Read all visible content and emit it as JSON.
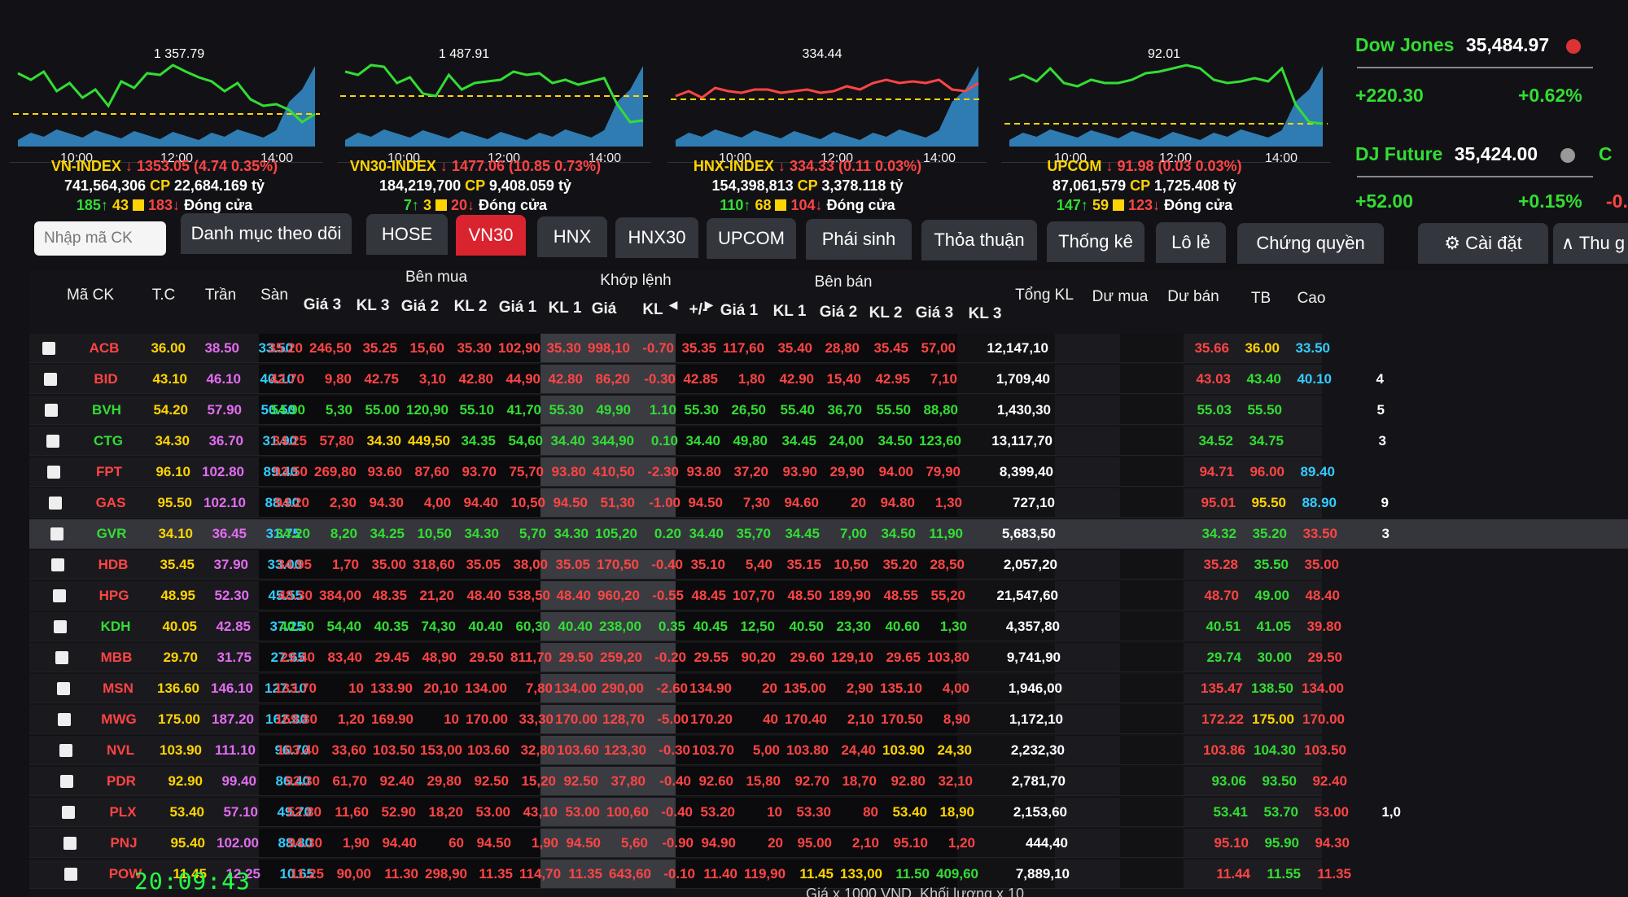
{
  "charts": [
    {
      "peak": "1 357.79",
      "times": [
        "10:00",
        "12:00",
        "14:00"
      ]
    },
    {
      "peak": "1 487.91",
      "times": [
        "10:00",
        "12:00",
        "14:00"
      ]
    },
    {
      "peak": "334.44",
      "times": [
        "10:00",
        "12:00",
        "14:00"
      ]
    },
    {
      "peak": "92.01",
      "times": [
        "10:00",
        "12:00",
        "14:00"
      ]
    }
  ],
  "indices": [
    {
      "name": "VN-INDEX",
      "value": "1353.05",
      "change": "(4.74  0.35%)",
      "volume": "741,564,306",
      "cp": "CP",
      "value_total": "22,684.169 tỷ",
      "ups": "185",
      "refs": "43",
      "downs": "183",
      "status": "Đóng cửa"
    },
    {
      "name": "VN30-INDEX",
      "value": "1477.06",
      "change": "(10.85  0.73%)",
      "volume": "184,219,700",
      "cp": "CP",
      "value_total": "9,408.059 tỷ",
      "ups": "7",
      "refs": "3",
      "downs": "20",
      "status": "Đóng cửa"
    },
    {
      "name": "HNX-INDEX",
      "value": "334.33",
      "change": "(0.11  0.03%)",
      "volume": "154,398,813",
      "cp": "CP",
      "value_total": "3,378.118 tỷ",
      "ups": "110",
      "refs": "68",
      "downs": "104",
      "status": "Đóng cửa"
    },
    {
      "name": "UPCOM",
      "value": "91.98",
      "change": "(0.03  0.03%)",
      "volume": "87,061,579",
      "cp": "CP",
      "value_total": "1,725.408 tỷ",
      "ups": "147",
      "refs": "59",
      "downs": "123",
      "status": "Đóng cửa"
    }
  ],
  "world": {
    "dow_name": "Dow Jones",
    "dow_value": "35,484.97",
    "dow_change": "+220.30",
    "dow_pct": "+0.62%",
    "djf_name": "DJ Future",
    "djf_value": "35,424.00",
    "djf_change": "+52.00",
    "djf_pct": "+0.15%",
    "partial": "C",
    "partial2": "-0."
  },
  "search": {
    "placeholder": "Nhập mã CK"
  },
  "tabs": [
    "Danh mục theo dõi",
    "HOSE",
    "VN30",
    "HNX",
    "HNX30",
    "UPCOM",
    "Phái sinh",
    "Thỏa thuận",
    "Thống kê",
    "Lô lẻ",
    "Chứng quyền"
  ],
  "settings_label": "Cài đặt",
  "collapse_label": "Thu g",
  "headers": {
    "symbol": "Mã CK",
    "ref": "T.C",
    "ceil": "Trần",
    "floor": "Sàn",
    "buy": "Bên mua",
    "match": "Khớp lệnh",
    "sell": "Bên bán",
    "p3": "Giá 3",
    "v3": "KL 3",
    "p2": "Giá 2",
    "v2": "KL 2",
    "p1": "Giá 1",
    "v1": "KL 1",
    "mp": "Giá",
    "mv": "KL",
    "mc": "+/-",
    "total": "Tổng KL",
    "bid_rem": "Dư mua",
    "ask_rem": "Dư bán",
    "avg": "TB",
    "high": "Cao"
  },
  "rows": [
    [
      "ACB",
      "36.00",
      "38.50",
      "33.50",
      "35.20",
      "246,50",
      "35.25",
      "15,60",
      "35.30",
      "102,90",
      "35.30",
      "998,10",
      "-0.70",
      "35.35",
      "117,60",
      "35.40",
      "28,80",
      "35.45",
      "57,00",
      "12,147,10",
      "35.66",
      "36.00"
    ],
    [
      "BID",
      "43.10",
      "46.10",
      "40.10",
      "42.70",
      "9,80",
      "42.75",
      "3,10",
      "42.80",
      "44,90",
      "42.80",
      "86,20",
      "-0.30",
      "42.85",
      "1,80",
      "42.90",
      "15,40",
      "42.95",
      "7,10",
      "1,709,40",
      "43.03",
      "43.40"
    ],
    [
      "BVH",
      "54.20",
      "57.90",
      "50.50",
      "54.90",
      "5,30",
      "55.00",
      "120,90",
      "55.10",
      "41,70",
      "55.30",
      "49,90",
      "1.10",
      "55.30",
      "26,50",
      "55.40",
      "36,70",
      "55.50",
      "88,80",
      "1,430,30",
      "55.03",
      "55.50"
    ],
    [
      "CTG",
      "34.30",
      "36.70",
      "31.90",
      "34.25",
      "57,80",
      "34.30",
      "449,50",
      "34.35",
      "54,60",
      "34.40",
      "344,90",
      "0.10",
      "34.40",
      "49,80",
      "34.45",
      "24,00",
      "34.50",
      "123,60",
      "13,117,70",
      "34.52",
      "34.75"
    ],
    [
      "FPT",
      "96.10",
      "102.80",
      "89.40",
      "93.50",
      "269,80",
      "93.60",
      "87,60",
      "93.70",
      "75,70",
      "93.80",
      "410,50",
      "-2.30",
      "93.80",
      "37,20",
      "93.90",
      "29,90",
      "94.00",
      "79,90",
      "8,399,40",
      "94.71",
      "96.00"
    ],
    [
      "GAS",
      "95.50",
      "102.10",
      "88.90",
      "94.20",
      "2,30",
      "94.30",
      "4,00",
      "94.40",
      "10,50",
      "94.50",
      "51,30",
      "-1.00",
      "94.50",
      "7,30",
      "94.60",
      "20",
      "94.80",
      "1,30",
      "727,10",
      "95.01",
      "95.50"
    ],
    [
      "GVR",
      "34.10",
      "36.45",
      "31.75",
      "34.20",
      "8,20",
      "34.25",
      "10,50",
      "34.30",
      "5,70",
      "34.30",
      "105,20",
      "0.20",
      "34.40",
      "35,70",
      "34.45",
      "7,00",
      "34.50",
      "11,90",
      "5,683,50",
      "34.32",
      "35.20"
    ],
    [
      "HDB",
      "35.45",
      "37.90",
      "33.00",
      "34.95",
      "1,70",
      "35.00",
      "318,60",
      "35.05",
      "38,00",
      "35.05",
      "170,50",
      "-0.40",
      "35.10",
      "5,40",
      "35.15",
      "10,50",
      "35.20",
      "28,50",
      "2,057,20",
      "35.28",
      "35.50"
    ],
    [
      "HPG",
      "48.95",
      "52.30",
      "45.55",
      "48.30",
      "384,00",
      "48.35",
      "21,20",
      "48.40",
      "538,50",
      "48.40",
      "960,20",
      "-0.55",
      "48.45",
      "107,70",
      "48.50",
      "189,90",
      "48.55",
      "55,20",
      "21,547,60",
      "48.70",
      "49.00"
    ],
    [
      "KDH",
      "40.05",
      "42.85",
      "37.25",
      "40.30",
      "54,40",
      "40.35",
      "74,30",
      "40.40",
      "60,30",
      "40.40",
      "238,00",
      "0.35",
      "40.45",
      "12,50",
      "40.50",
      "23,30",
      "40.60",
      "1,30",
      "4,357,80",
      "40.51",
      "41.05"
    ],
    [
      "MBB",
      "29.70",
      "31.75",
      "27.65",
      "29.40",
      "83,40",
      "29.45",
      "48,90",
      "29.50",
      "811,70",
      "29.50",
      "259,20",
      "-0.20",
      "29.55",
      "90,20",
      "29.60",
      "129,10",
      "29.65",
      "103,80",
      "9,741,90",
      "29.74",
      "30.00"
    ],
    [
      "MSN",
      "136.60",
      "146.10",
      "127.10",
      "133.70",
      "10",
      "133.90",
      "20,10",
      "134.00",
      "7,80",
      "134.00",
      "290,00",
      "-2.60",
      "134.90",
      "20",
      "135.00",
      "2,90",
      "135.10",
      "4,00",
      "1,946,00",
      "135.47",
      "138.50"
    ],
    [
      "MWG",
      "175.00",
      "187.20",
      "162.80",
      "169.80",
      "1,20",
      "169.90",
      "10",
      "170.00",
      "33,30",
      "170.00",
      "128,70",
      "-5.00",
      "170.20",
      "40",
      "170.40",
      "2,10",
      "170.50",
      "8,90",
      "1,172,10",
      "172.22",
      "175.00"
    ],
    [
      "NVL",
      "103.90",
      "111.10",
      "96.70",
      "103.40",
      "33,60",
      "103.50",
      "153,00",
      "103.60",
      "32,80",
      "103.60",
      "123,30",
      "-0.30",
      "103.70",
      "5,00",
      "103.80",
      "24,40",
      "103.90",
      "24,30",
      "2,232,30",
      "103.86",
      "104.30"
    ],
    [
      "PDR",
      "92.90",
      "99.40",
      "86.40",
      "92.30",
      "61,70",
      "92.40",
      "29,80",
      "92.50",
      "15,20",
      "92.50",
      "37,80",
      "-0.40",
      "92.60",
      "15,80",
      "92.70",
      "18,70",
      "92.80",
      "32,10",
      "2,781,70",
      "93.06",
      "93.50"
    ],
    [
      "PLX",
      "53.40",
      "57.10",
      "49.70",
      "52.80",
      "11,60",
      "52.90",
      "18,20",
      "53.00",
      "43,10",
      "53.00",
      "100,60",
      "-0.40",
      "53.20",
      "10",
      "53.30",
      "80",
      "53.40",
      "18,90",
      "2,153,60",
      "53.41",
      "53.70"
    ],
    [
      "PNJ",
      "95.40",
      "102.00",
      "88.80",
      "94.30",
      "1,90",
      "94.40",
      "60",
      "94.50",
      "1,90",
      "94.50",
      "5,60",
      "-0.90",
      "94.90",
      "20",
      "95.00",
      "2,10",
      "95.10",
      "1,20",
      "444,40",
      "95.10",
      "95.90"
    ],
    [
      "POW",
      "11.45",
      "12.25",
      "10.65",
      "11.25",
      "90,00",
      "11.30",
      "298,90",
      "11.35",
      "114,70",
      "11.35",
      "643,60",
      "-0.10",
      "11.40",
      "119,90",
      "11.45",
      "133,00",
      "11.50",
      "409,60",
      "7,889,10",
      "11.44",
      "11.55"
    ]
  ],
  "extra_right": [
    [
      "33.50",
      ""
    ],
    [
      "40.10",
      "4"
    ],
    [
      "",
      "5"
    ],
    [
      "",
      "3"
    ],
    [
      "89.40",
      ""
    ],
    [
      "88.90",
      "9"
    ],
    [
      "33.50",
      "3"
    ],
    [
      "35.00",
      ""
    ],
    [
      "48.40",
      ""
    ],
    [
      "39.80",
      ""
    ],
    [
      "29.50",
      ""
    ],
    [
      "134.00",
      ""
    ],
    [
      "170.00",
      ""
    ],
    [
      "103.50",
      ""
    ],
    [
      "92.40",
      ""
    ],
    [
      "53.00",
      "1,0"
    ],
    [
      "94.30",
      ""
    ],
    [
      "11.35",
      ""
    ]
  ],
  "clock": "20:09:43",
  "footer_note": "Giá x 1000 VND. Khối lượng x 10",
  "colors": {
    "up": "#33dd33",
    "down": "#ff4444",
    "ref": "#ffd400",
    "ceil": "#e36cf2",
    "floor": "#33ccff",
    "active_tab": "#d9232e"
  }
}
